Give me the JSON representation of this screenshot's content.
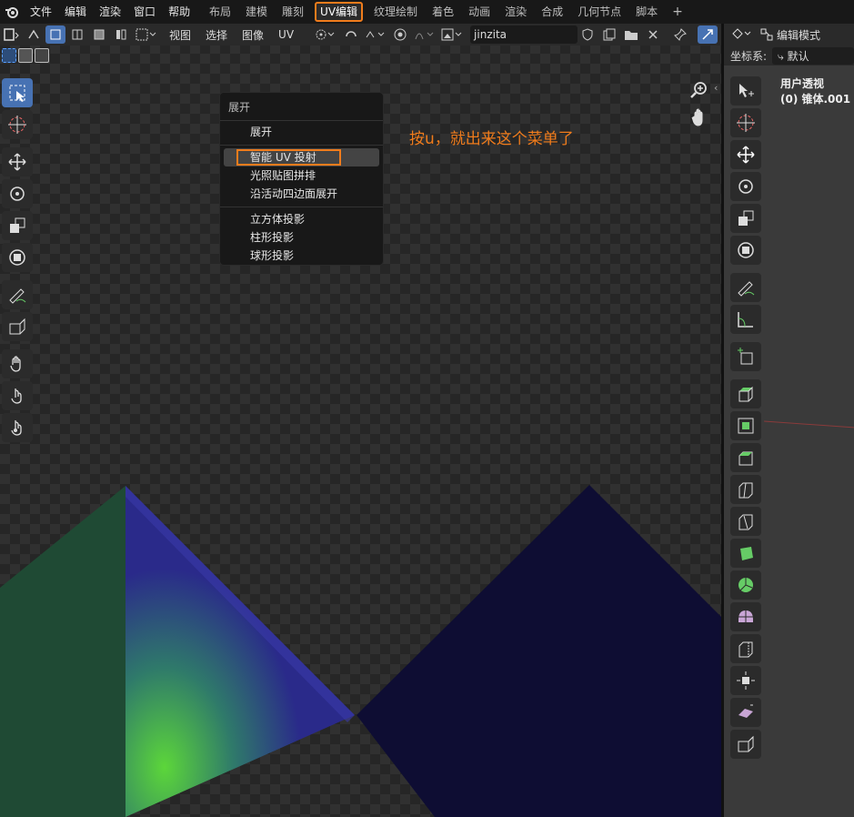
{
  "topbar": {
    "menus": [
      "文件",
      "编辑",
      "渲染",
      "窗口",
      "帮助"
    ],
    "workspaces": [
      "布局",
      "建模",
      "雕刻",
      "UV编辑",
      "纹理绘制",
      "着色",
      "动画",
      "渲染",
      "合成",
      "几何节点",
      "脚本"
    ],
    "active_workspace": "UV编辑",
    "add_tab": "+"
  },
  "uv_header": {
    "menus": [
      "视图",
      "选择",
      "图像",
      "UV"
    ],
    "image_name": "jinzita"
  },
  "context_menu": {
    "title": "展开",
    "items": [
      "展开",
      "智能 UV 投射",
      "光照贴图拼排",
      "沿活动四边面展开",
      "立方体投影",
      "柱形投影",
      "球形投影"
    ],
    "highlighted": "智能 UV 投射"
  },
  "annotation": "按u，就出来这个菜单了",
  "viewport": {
    "mode": "编辑模式",
    "coord_label": "坐标系:",
    "coord_value": "默认",
    "overlay_line1": "用户透视",
    "overlay_line2": "(0) 锥体.001"
  },
  "colors": {
    "accent": "#4772b3",
    "highlight": "#f07c1c"
  }
}
